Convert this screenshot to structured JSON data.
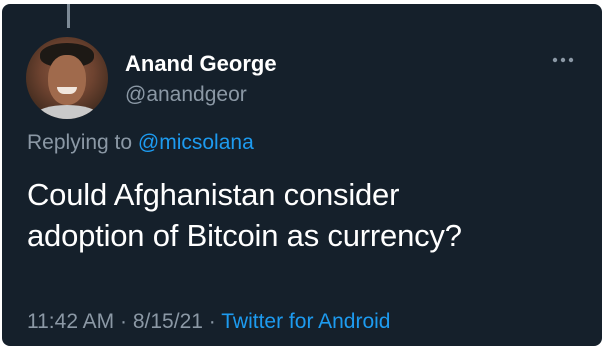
{
  "tweet": {
    "display_name": "Anand George",
    "handle": "@anandgeor",
    "replying_prefix": "Replying to",
    "replying_to": "@micsolana",
    "text_line1": "Could Afghanistan consider",
    "text_line2": "adoption of Bitcoin as currency?",
    "time": "11:42 AM",
    "separator": "·",
    "date": "8/15/21",
    "source": "Twitter for Android"
  },
  "icons": {
    "more": "more-horizontal-icon",
    "avatar": "avatar-photo"
  },
  "colors": {
    "background": "#15202b",
    "text": "#ffffff",
    "muted": "#8b98a5",
    "link": "#1d9bf0"
  }
}
